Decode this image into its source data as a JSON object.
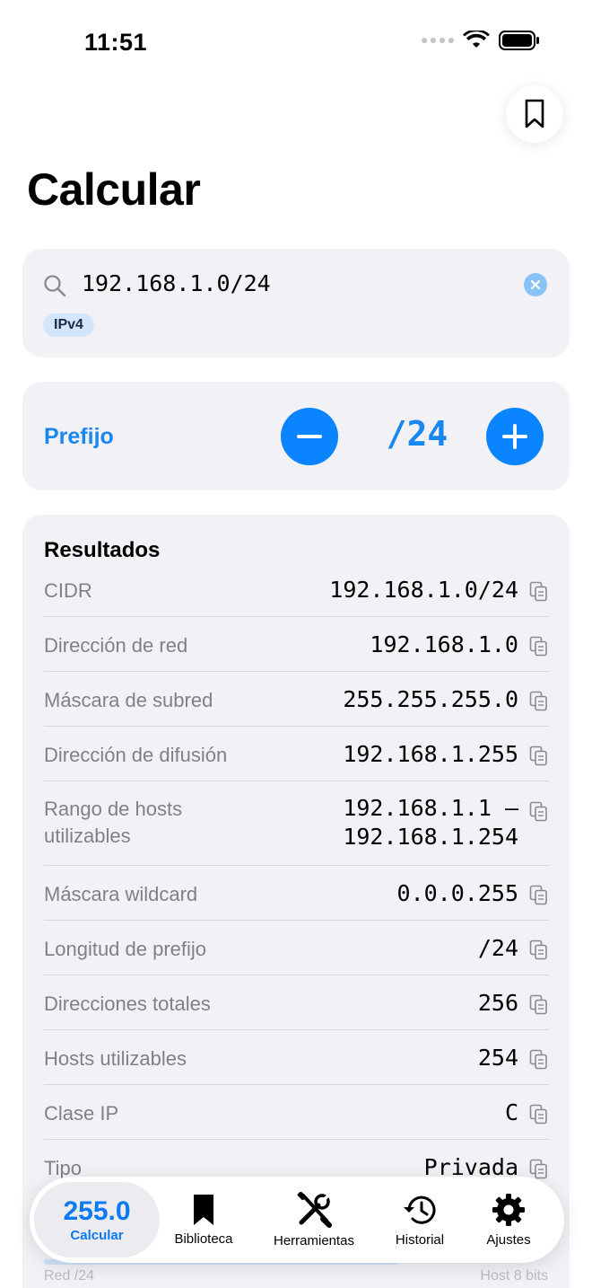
{
  "status": {
    "time": "11:51"
  },
  "page": {
    "title": "Calcular"
  },
  "search": {
    "value": "192.168.1.0/24",
    "badge": "IPv4"
  },
  "prefix": {
    "label": "Prefijo",
    "value": "/24"
  },
  "results": {
    "title": "Resultados",
    "rows": [
      {
        "label": "CIDR",
        "value": "192.168.1.0/24"
      },
      {
        "label": "Dirección de red",
        "value": "192.168.1.0"
      },
      {
        "label": "Máscara de subred",
        "value": "255.255.255.0"
      },
      {
        "label": "Dirección de difusión",
        "value": "192.168.1.255"
      },
      {
        "label": "Rango de hosts utilizables",
        "value": "192.168.1.1 — 192.168.1.254"
      },
      {
        "label": "Máscara wildcard",
        "value": "0.0.0.255"
      },
      {
        "label": "Longitud de prefijo",
        "value": "/24"
      },
      {
        "label": "Direcciones totales",
        "value": "256"
      },
      {
        "label": "Hosts utilizables",
        "value": "254"
      },
      {
        "label": "Clase IP",
        "value": "C"
      },
      {
        "label": "Tipo",
        "value": "Privada"
      }
    ]
  },
  "peek": {
    "left": "Red /24",
    "right": "Host 8 bits"
  },
  "tabs": [
    {
      "label": "Calcular",
      "badge": "255.0",
      "icon": "calculator-badge",
      "active": true
    },
    {
      "label": "Biblioteca",
      "icon": "bookmark-icon"
    },
    {
      "label": "Herramientas",
      "icon": "tools-icon"
    },
    {
      "label": "Historial",
      "icon": "history-icon"
    },
    {
      "label": "Ajustes",
      "icon": "gear-icon"
    }
  ],
  "colors": {
    "accent": "#0a84ff",
    "card": "#f1f1f6"
  }
}
